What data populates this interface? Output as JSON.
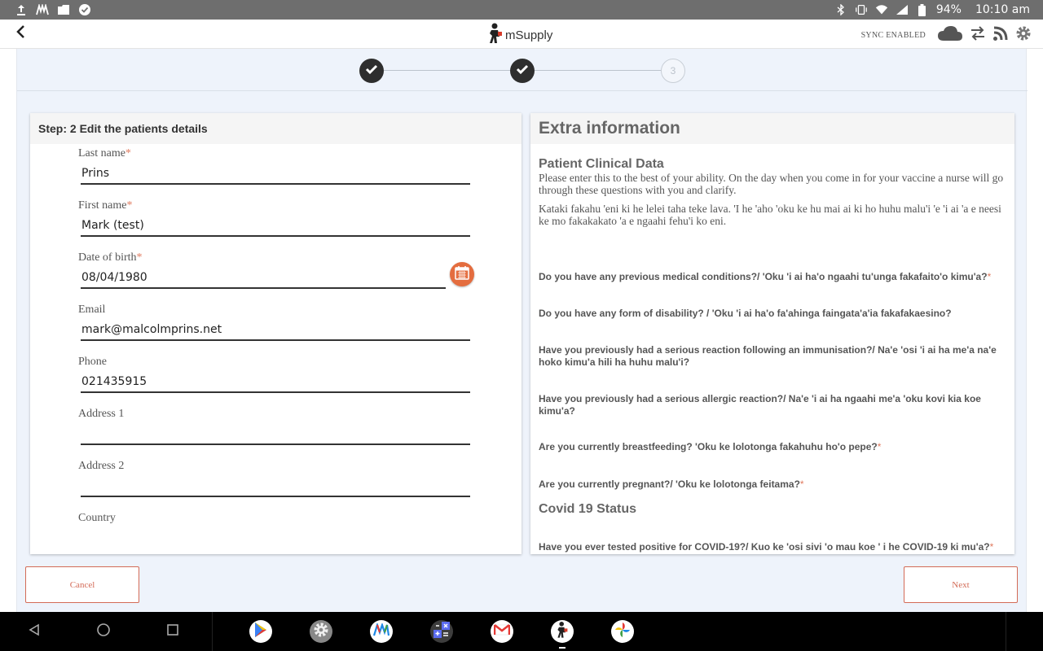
{
  "statusbar": {
    "battery": "94%",
    "time": "10:10 am",
    "left_icons": [
      "upload-icon",
      "app-icon",
      "photos-icon",
      "check-circle-icon"
    ],
    "right_icons": [
      "bluetooth-icon",
      "vibrate-icon",
      "wifi-icon",
      "signal-icon",
      "battery-icon"
    ]
  },
  "appbar": {
    "brand": "mSupply",
    "sync_status": "SYNC ENABLED"
  },
  "stepper": {
    "step3_label": "3"
  },
  "left_panel": {
    "title": "Step: 2 Edit the patients details",
    "fields": [
      {
        "label": "Last name",
        "required": "*",
        "value": "Prins"
      },
      {
        "label": "First name",
        "required": "*",
        "value": "Mark (test)"
      },
      {
        "label": "Date of birth",
        "required": "*",
        "value": "08/04/1980"
      },
      {
        "label": "Email",
        "value": "mark@malcolmprins.net"
      },
      {
        "label": "Phone",
        "value": "021435915"
      },
      {
        "label": "Address 1",
        "value": ""
      },
      {
        "label": "Address 2",
        "value": ""
      },
      {
        "label": "Country"
      }
    ]
  },
  "right_panel": {
    "title": "Extra information",
    "section1": "Patient Clinical Data",
    "intro_en": "Please enter this to the best of your ability. On the day when you come in for your vaccine a nurse will go through these questions with you and clarify.",
    "intro_to": "Kataki fakahu 'eni ki he lelei taha teke lava. 'I he 'aho 'oku ke hu mai ai ki ho huhu malu'i 'e 'i ai 'a e neesi ke mo fakakakato 'a e ngaahi fehu'i ko eni.",
    "questions": [
      {
        "text": "Do you have any previous medical conditions?/ 'Oku 'i ai ha'o ngaahi tu'unga fakafaito'o kimu'a?",
        "required": "*"
      },
      {
        "text": "Do you have any form of disability? / 'Oku 'i ai ha'o fa'ahinga faingata'a'ia fakafakaesino?"
      },
      {
        "text": "Have you previously had a serious reaction following an immunisation?/ Na'e 'osi 'i ai ha me'a na'e hoko kimu'a hili ha huhu malu'i?"
      },
      {
        "text": "Have you previously had a serious allergic reaction?/ Na'e 'i ai ha ngaahi me'a 'oku kovi kia koe kimu'a?"
      },
      {
        "text": "Are you currently breastfeeding? 'Oku ke lolotonga fakahuhu ho'o pepe?",
        "required": "*"
      },
      {
        "text": "Are you currently pregnant?/ 'Oku ke lolotonga feitama?",
        "required": "*"
      },
      {
        "text": "Have you ever tested positive for COVID-19?/ Kuo ke 'osi sivi 'o mau koe ' i he COVID-19 ki mu'a?",
        "required": "*"
      }
    ],
    "section2": "Covid 19 Status"
  },
  "footer": {
    "cancel_label": "Cancel",
    "next_label": "Next"
  },
  "colors": {
    "accent": "#e46d3f",
    "button_border": "#d36b57",
    "background": "#eef3fb"
  }
}
